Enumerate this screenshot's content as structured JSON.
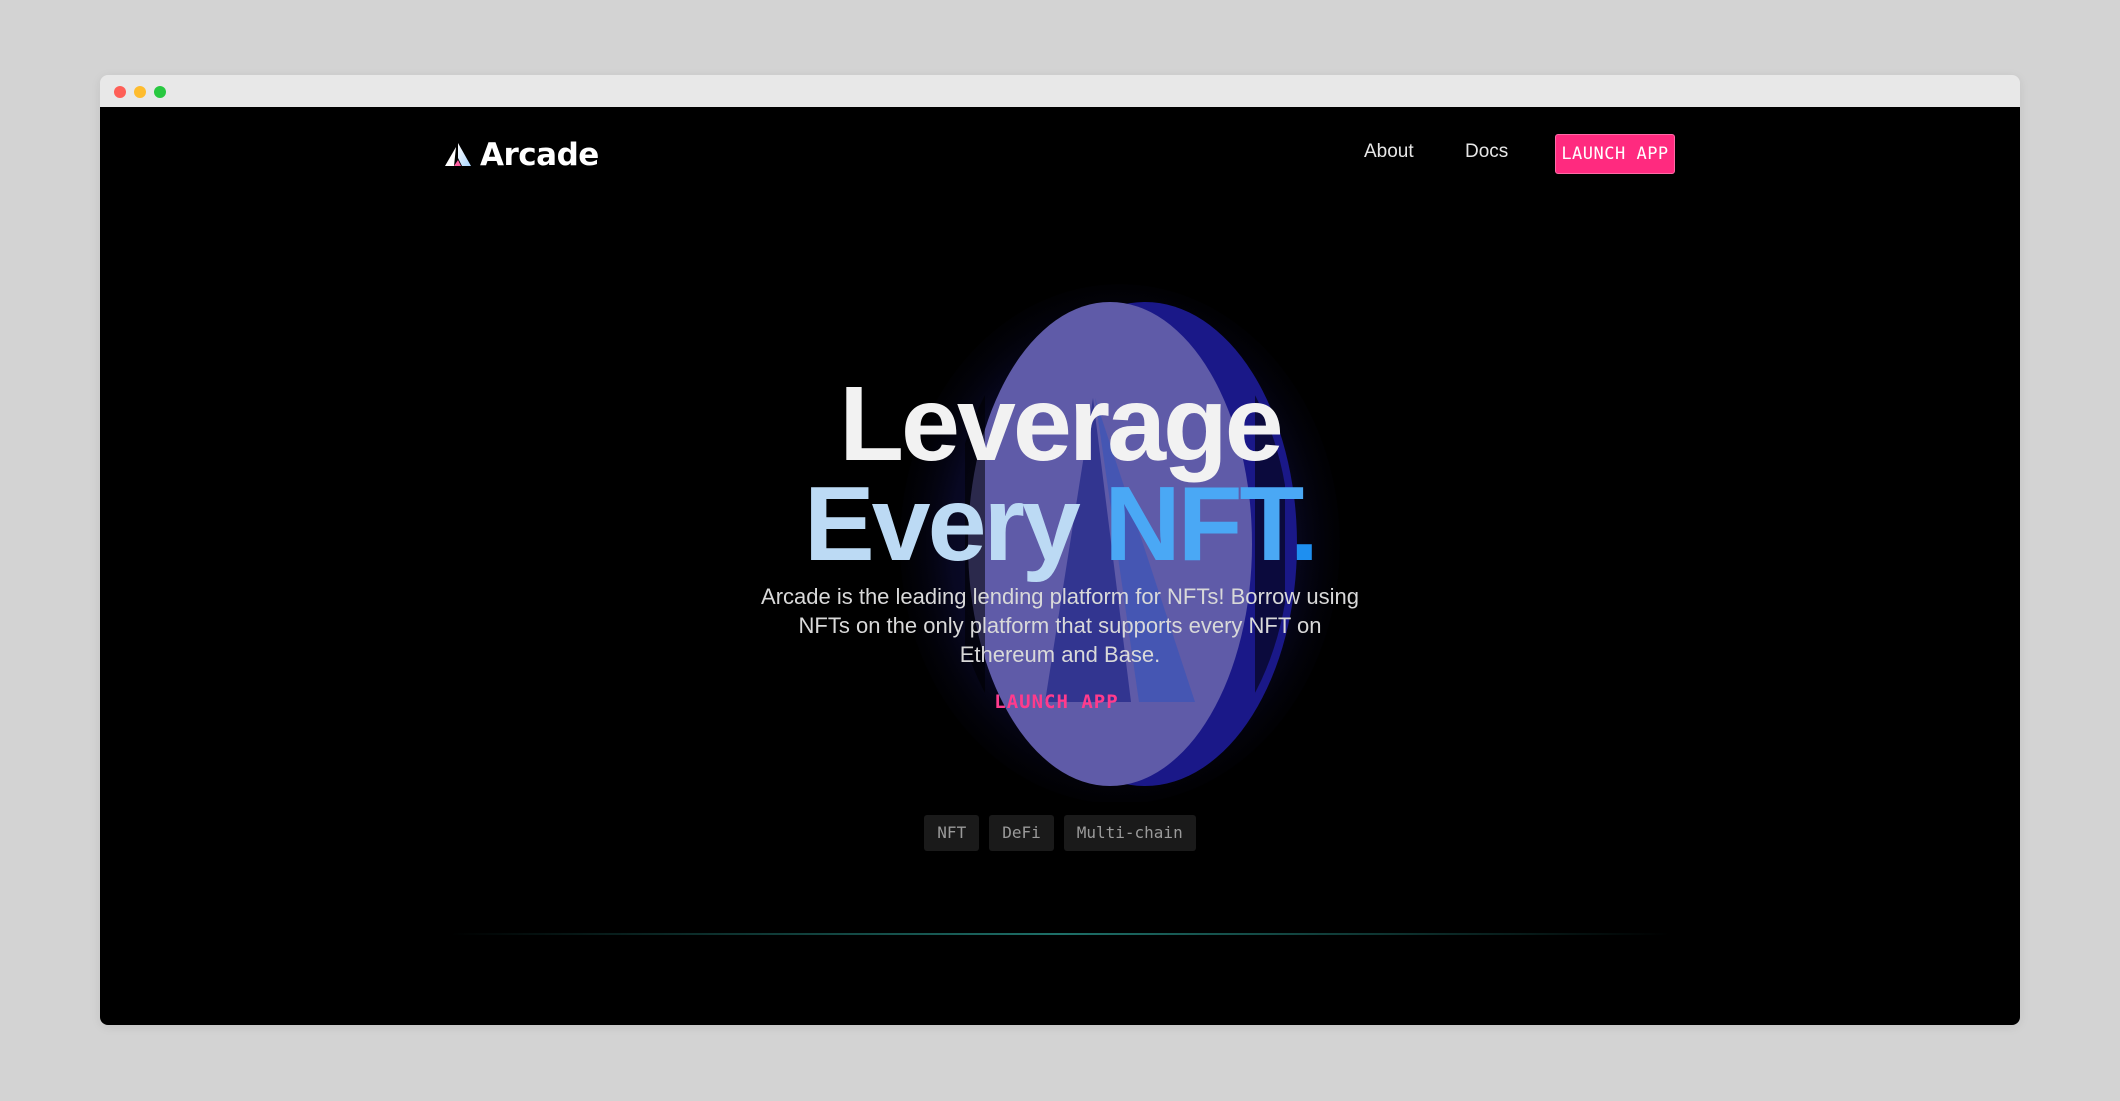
{
  "brand": {
    "name": "Arcade"
  },
  "nav": {
    "links": [
      {
        "label": "About"
      },
      {
        "label": "Docs"
      }
    ],
    "cta_label": "LAUNCH APP"
  },
  "hero": {
    "title_line1": "Leverage",
    "title_every": "Every",
    "title_nft": "NFT",
    "title_period": ".",
    "subtitle": "Arcade is the leading lending platform for NFTs! Borrow using NFTs on the only platform that supports every NFT on Ethereum and Base.",
    "cta_label": "LAUNCH APP"
  },
  "tags": [
    "NFT",
    "DeFi",
    "Multi-chain"
  ],
  "colors": {
    "background": "#000000",
    "cta_pink": "#ff2a7f",
    "accent_blue": "#4aa8f5",
    "divider_teal": "#289690"
  }
}
